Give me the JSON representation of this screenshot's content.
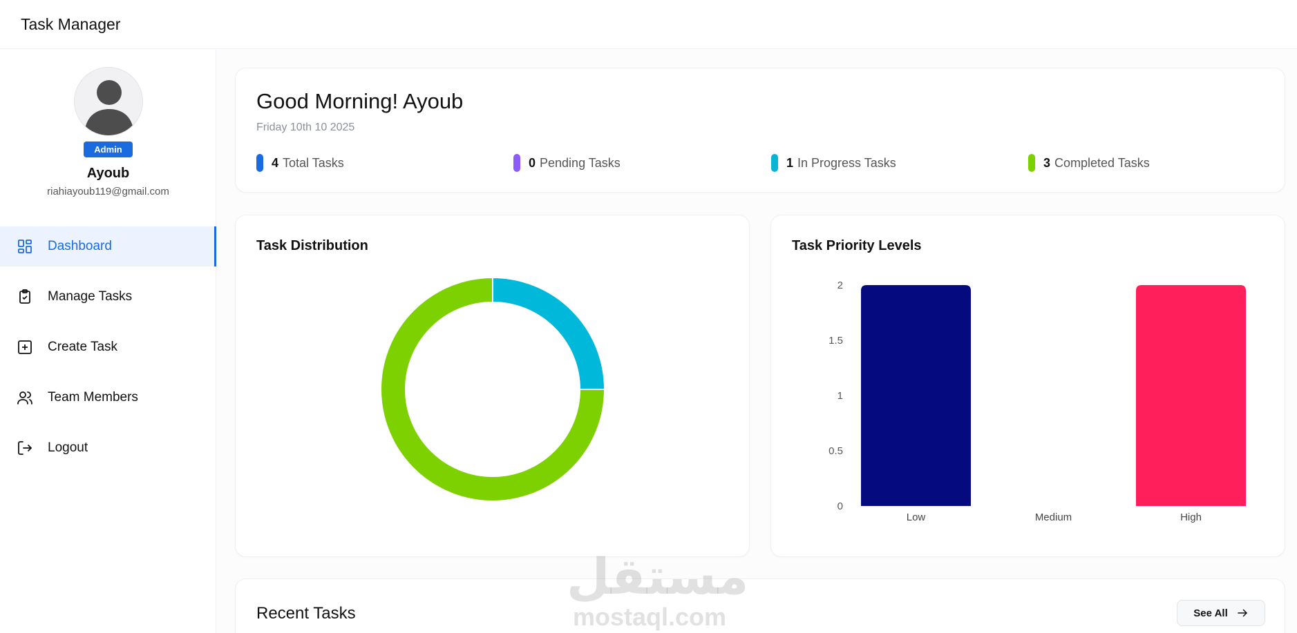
{
  "app": {
    "title": "Task Manager"
  },
  "profile": {
    "role": "Admin",
    "name": "Ayoub",
    "email": "riahiayoub119@gmail.com"
  },
  "nav": [
    {
      "label": "Dashboard",
      "icon": "dashboard-icon",
      "active": true
    },
    {
      "label": "Manage Tasks",
      "icon": "clipboard-check-icon",
      "active": false
    },
    {
      "label": "Create Task",
      "icon": "plus-square-icon",
      "active": false
    },
    {
      "label": "Team Members",
      "icon": "users-icon",
      "active": false
    },
    {
      "label": "Logout",
      "icon": "logout-icon",
      "active": false
    }
  ],
  "greeting": {
    "title": "Good Morning! Ayoub",
    "date": "Friday 10th 10 2025"
  },
  "stats": [
    {
      "value": "4",
      "label": "Total Tasks",
      "color": "#1a6be0"
    },
    {
      "value": "0",
      "label": "Pending Tasks",
      "color": "#8b5cf6"
    },
    {
      "value": "1",
      "label": "In Progress Tasks",
      "color": "#06b6d4"
    },
    {
      "value": "3",
      "label": "Completed Tasks",
      "color": "#7ed100"
    }
  ],
  "distribution_card": {
    "title": "Task Distribution"
  },
  "priority_card": {
    "title": "Task Priority Levels"
  },
  "chart_data": [
    {
      "type": "pie",
      "title": "Task Distribution",
      "slices": [
        {
          "label": "Pending",
          "value": 0,
          "color": "#8b5cf6"
        },
        {
          "label": "In Progress",
          "value": 1,
          "color": "#00b8d9"
        },
        {
          "label": "Completed",
          "value": 3,
          "color": "#7ed100"
        }
      ]
    },
    {
      "type": "bar",
      "title": "Task Priority Levels",
      "categories": [
        "Low",
        "Medium",
        "High"
      ],
      "values": [
        2,
        0,
        2
      ],
      "colors": [
        "#050b7f",
        "#8b5cf6",
        "#ff1f5a"
      ],
      "ylim": [
        0,
        2
      ],
      "yticks": [
        "0",
        "0.5",
        "1",
        "1.5",
        "2"
      ],
      "grid": false
    }
  ],
  "recent": {
    "title": "Recent Tasks",
    "see_all_label": "See All"
  },
  "watermark": {
    "arabic": "مستقل",
    "latin": "mostaql.com"
  }
}
